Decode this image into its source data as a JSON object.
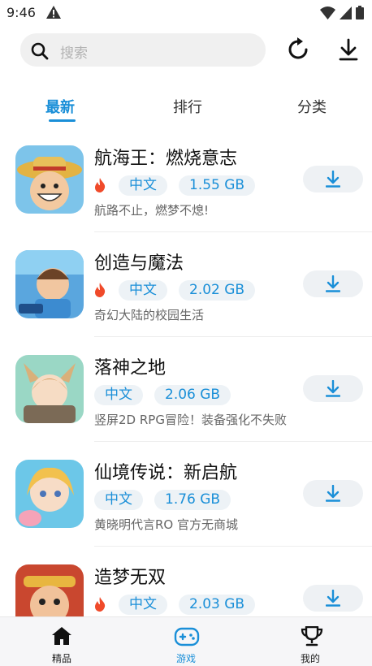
{
  "status_bar": {
    "time": "9:46",
    "icons": [
      "warning-icon",
      "wifi-icon",
      "cellular-icon",
      "battery-icon"
    ]
  },
  "header": {
    "search_placeholder": "搜索",
    "icons": [
      "search-icon",
      "refresh-icon",
      "download-icon"
    ]
  },
  "tabs": [
    {
      "label": "最新",
      "active": true
    },
    {
      "label": "排行",
      "active": false
    },
    {
      "label": "分类",
      "active": false
    }
  ],
  "games": [
    {
      "title": "航海王：燃烧意志",
      "hot": true,
      "lang": "中文",
      "size": "1.55 GB",
      "desc": "航路不止，燃梦不熄!",
      "icon_color": "#e59b3a"
    },
    {
      "title": "创造与魔法",
      "hot": true,
      "lang": "中文",
      "size": "2.02 GB",
      "desc": "奇幻大陆的校园生活",
      "icon_color": "#5aa6de"
    },
    {
      "title": "落神之地",
      "hot": false,
      "lang": "中文",
      "size": "2.06 GB",
      "desc": "竖屏2D RPG冒险！装备强化不失败",
      "icon_color": "#d9b07a"
    },
    {
      "title": "仙境传说：新启航",
      "hot": false,
      "lang": "中文",
      "size": "1.76 GB",
      "desc": "黄晓明代言RO 官方无商城",
      "icon_color": "#f2c39a"
    },
    {
      "title": "造梦无双",
      "hot": true,
      "lang": "中文",
      "size": "2.03 GB",
      "desc": "",
      "icon_color": "#c9472f"
    }
  ],
  "bottom_nav": [
    {
      "label": "精品",
      "icon": "home-icon",
      "active": false
    },
    {
      "label": "游戏",
      "icon": "gamepad-icon",
      "active": true
    },
    {
      "label": "我的",
      "icon": "trophy-icon",
      "active": false
    }
  ],
  "colors": {
    "accent": "#1a8fd8",
    "hot": "#f04a2a",
    "tag_bg": "#edf2f6"
  }
}
